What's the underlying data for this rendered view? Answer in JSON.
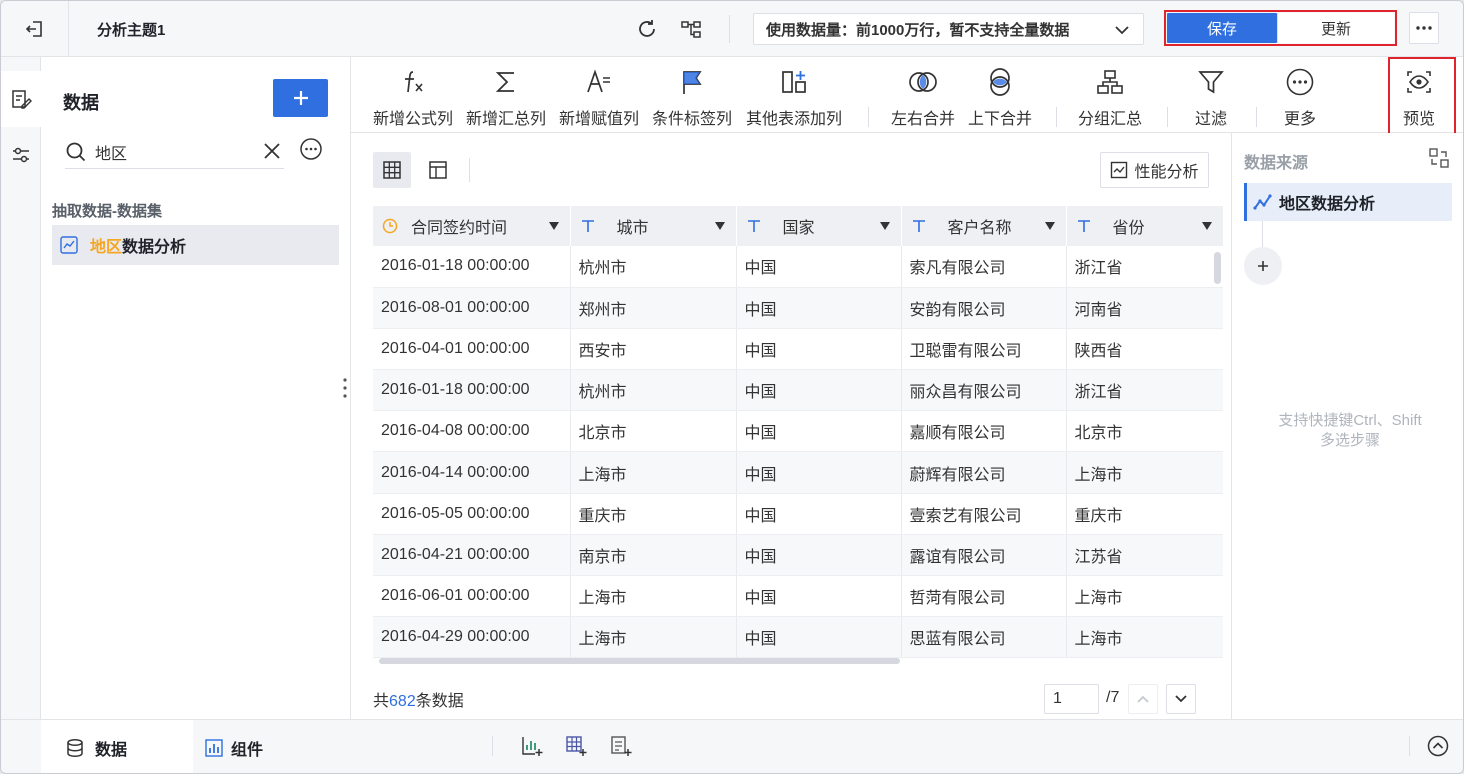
{
  "topbar": {
    "title": "分析主题1",
    "data_limit": "使用数据量：前1000万行，暂不支持全量数据",
    "save_label": "保存",
    "update_label": "更新"
  },
  "data_panel": {
    "title": "数据",
    "search_value": "地区",
    "group_label": "抽取数据-数据集",
    "dataset_highlight": "地区",
    "dataset_rest": "数据分析"
  },
  "toolbar": {
    "items": [
      {
        "label": "新增公式列",
        "icon": "formula-icon"
      },
      {
        "label": "新增汇总列",
        "icon": "sum-icon"
      },
      {
        "label": "新增赋值列",
        "icon": "assign-icon"
      },
      {
        "label": "条件标签列",
        "icon": "flag-icon"
      },
      {
        "label": "其他表添加列",
        "icon": "add-column-icon"
      },
      {
        "label": "左右合并",
        "icon": "merge-lr-icon"
      },
      {
        "label": "上下合并",
        "icon": "merge-ud-icon"
      },
      {
        "label": "分组汇总",
        "icon": "group-icon"
      },
      {
        "label": "过滤",
        "icon": "filter-icon"
      },
      {
        "label": "更多",
        "icon": "more-icon"
      },
      {
        "label": "预览",
        "icon": "eye-icon"
      }
    ]
  },
  "table": {
    "perf_label": "性能分析",
    "columns": [
      "合同签约时间",
      "城市",
      "国家",
      "客户名称",
      "省份"
    ],
    "rows": [
      [
        "2016-01-18 00:00:00",
        "杭州市",
        "中国",
        "索凡有限公司",
        "浙江省"
      ],
      [
        "2016-08-01 00:00:00",
        "郑州市",
        "中国",
        "安韵有限公司",
        "河南省"
      ],
      [
        "2016-04-01 00:00:00",
        "西安市",
        "中国",
        "卫聪雷有限公司",
        "陕西省"
      ],
      [
        "2016-01-18 00:00:00",
        "杭州市",
        "中国",
        "丽众昌有限公司",
        "浙江省"
      ],
      [
        "2016-04-08 00:00:00",
        "北京市",
        "中国",
        "嘉顺有限公司",
        "北京市"
      ],
      [
        "2016-04-14 00:00:00",
        "上海市",
        "中国",
        "蔚辉有限公司",
        "上海市"
      ],
      [
        "2016-05-05 00:00:00",
        "重庆市",
        "中国",
        "壹索艺有限公司",
        "重庆市"
      ],
      [
        "2016-04-21 00:00:00",
        "南京市",
        "中国",
        "露谊有限公司",
        "江苏省"
      ],
      [
        "2016-06-01 00:00:00",
        "上海市",
        "中国",
        "哲菏有限公司",
        "上海市"
      ],
      [
        "2016-04-29 00:00:00",
        "上海市",
        "中国",
        "思蓝有限公司",
        "上海市"
      ]
    ],
    "total_prefix": "共",
    "total_count": "682",
    "total_suffix": "条数据",
    "page_value": "1",
    "page_total": "/7"
  },
  "right_panel": {
    "title": "数据来源",
    "step_label": "地区数据分析",
    "hint_line1": "支持快捷键Ctrl、Shift",
    "hint_line2": "多选步骤"
  },
  "bottombar": {
    "tab_data": "数据",
    "tab_component": "组件"
  },
  "colors": {
    "primary": "#2f6fe0",
    "highlight": "#f5a623",
    "annotation_red": "#e0242d"
  }
}
